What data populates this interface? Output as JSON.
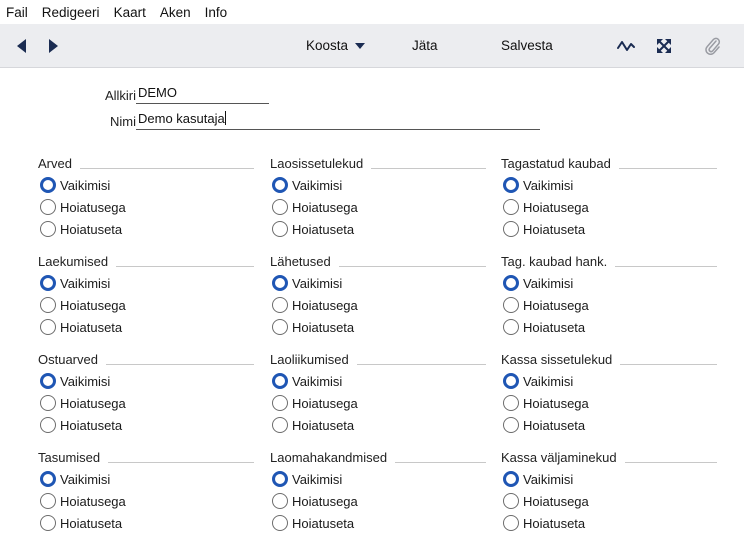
{
  "menubar": {
    "items": [
      "Fail",
      "Redigeeri",
      "Kaart",
      "Aken",
      "Info"
    ]
  },
  "toolbar": {
    "koosta_label": "Koosta",
    "jata_label": "Jäta",
    "salvesta_label": "Salvesta",
    "icons": [
      "prev-arrow-icon",
      "next-arrow-icon",
      "chevron-down-icon",
      "pulse-icon",
      "expand-icon",
      "paperclip-icon"
    ]
  },
  "form": {
    "allkiri_label": "Allkiri",
    "allkiri_value": "DEMO",
    "nimi_label": "Nimi",
    "nimi_value": "Demo kasutaja"
  },
  "colors": {
    "radio_selected": "#1f56b4",
    "toolbar_bg": "#ecedf0",
    "nav_arrow": "#1b2c52"
  },
  "options": [
    "Vaikimisi",
    "Hoiatusega",
    "Hoiatuseta"
  ],
  "groups": [
    {
      "title": "Arved",
      "selected": 0
    },
    {
      "title": "Laosissetulekud",
      "selected": 0
    },
    {
      "title": "Tagastatud kaubad",
      "selected": 0
    },
    {
      "title": "Laekumised",
      "selected": 0
    },
    {
      "title": "Lähetused",
      "selected": 0
    },
    {
      "title": "Tag. kaubad hank.",
      "selected": 0
    },
    {
      "title": "Ostuarved",
      "selected": 0
    },
    {
      "title": "Laoliikumised",
      "selected": 0
    },
    {
      "title": "Kassa sissetulekud",
      "selected": 0
    },
    {
      "title": "Tasumised",
      "selected": 0
    },
    {
      "title": "Laomahakandmised",
      "selected": 0
    },
    {
      "title": "Kassa väljaminekud",
      "selected": 0
    }
  ]
}
